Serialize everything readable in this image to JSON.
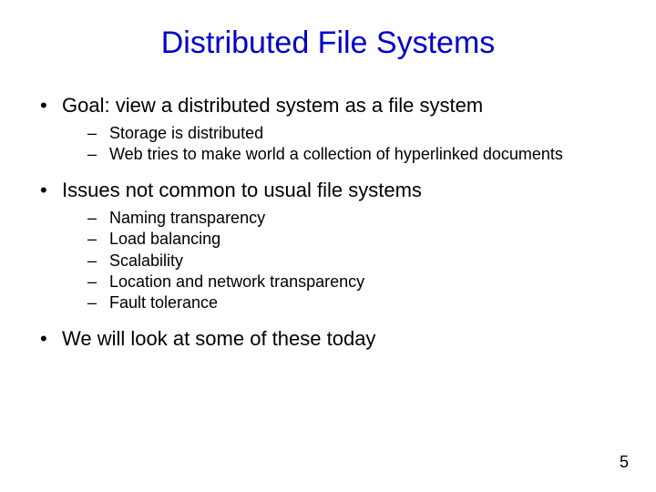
{
  "title": "Distributed File Systems",
  "bullets": [
    {
      "text": "Goal: view a distributed system as a file system",
      "sub": [
        "Storage is distributed",
        "Web tries to make world a collection of hyperlinked documents"
      ]
    },
    {
      "text": "Issues not common to usual file systems",
      "sub": [
        "Naming transparency",
        "Load balancing",
        "Scalability",
        "Location and network transparency",
        "Fault tolerance"
      ]
    },
    {
      "text": "We will look at some of these today",
      "sub": []
    }
  ],
  "pageNumber": "5"
}
